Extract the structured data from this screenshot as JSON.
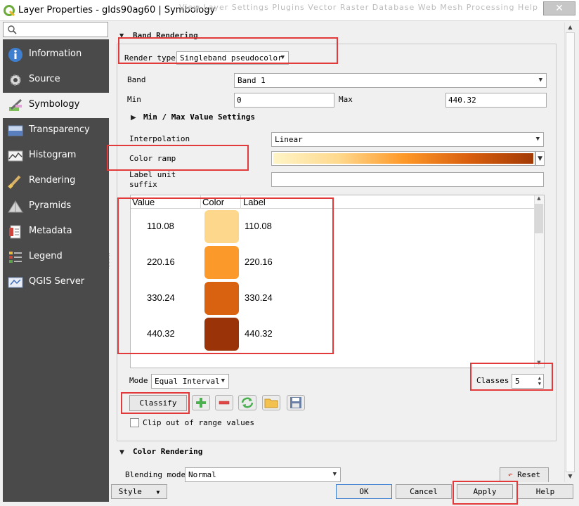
{
  "window": {
    "title": "Layer Properties - glds90ag60 | Symbology",
    "ghost_menu": "View   Layer   Settings   Plugins   Vector   Raster   Database   Web   Mesh   Processing   Help",
    "close_glyph": "✕"
  },
  "search": {
    "placeholder": ""
  },
  "sidebar": {
    "items": [
      {
        "label": "Information",
        "icon": "information-icon"
      },
      {
        "label": "Source",
        "icon": "source-gear-icon"
      },
      {
        "label": "Symbology",
        "icon": "symbology-brush-icon",
        "active": true
      },
      {
        "label": "Transparency",
        "icon": "transparency-icon"
      },
      {
        "label": "Histogram",
        "icon": "histogram-icon"
      },
      {
        "label": "Rendering",
        "icon": "rendering-brush-icon"
      },
      {
        "label": "Pyramids",
        "icon": "pyramids-icon"
      },
      {
        "label": "Metadata",
        "icon": "metadata-icon"
      },
      {
        "label": "Legend",
        "icon": "legend-icon"
      },
      {
        "label": "QGIS Server",
        "icon": "qgis-server-icon"
      }
    ]
  },
  "band_rendering": {
    "section_title": "Band Rendering",
    "render_type_label": "Render type",
    "render_type_value": "Singleband pseudocolor",
    "band_label": "Band",
    "band_value": "Band 1",
    "min_label": "Min",
    "min_value": "0",
    "max_label": "Max",
    "max_value": "440.32",
    "minmax_settings": "Min / Max Value Settings",
    "interpolation_label": "Interpolation",
    "interpolation_value": "Linear",
    "color_ramp_label": "Color ramp",
    "label_unit_suffix_label_1": "Label unit",
    "label_unit_suffix_label_2": "suffix",
    "label_unit_suffix_value": ""
  },
  "classes_table": {
    "headers": [
      "Value",
      "Color",
      "Label"
    ],
    "rows": [
      {
        "value": "110.08",
        "color": "#fdd88c",
        "label": "110.08"
      },
      {
        "value": "220.16",
        "color": "#fb9a2a",
        "label": "220.16"
      },
      {
        "value": "330.24",
        "color": "#d8620f",
        "label": "330.24"
      },
      {
        "value": "440.32",
        "color": "#9a3408",
        "label": "440.32"
      }
    ]
  },
  "classification": {
    "mode_label": "Mode",
    "mode_value": "Equal Interval",
    "classes_label": "Classes",
    "classes_value": "5",
    "classify_button": "Classify",
    "clip_label": "Clip out of range values"
  },
  "color_rendering": {
    "section_title": "Color Rendering",
    "blending_label": "Blending mode",
    "blending_value": "Normal",
    "reset_button": "Reset"
  },
  "footer": {
    "style_button": "Style",
    "ok_button": "OK",
    "cancel_button": "Cancel",
    "apply_button": "Apply",
    "help_button": "Help"
  },
  "colors": {
    "ramp_start": "#fff4c6",
    "ramp_end": "#a33a05",
    "highlight": "#e23a3a",
    "sidebar_bg": "#4a4a4a"
  }
}
